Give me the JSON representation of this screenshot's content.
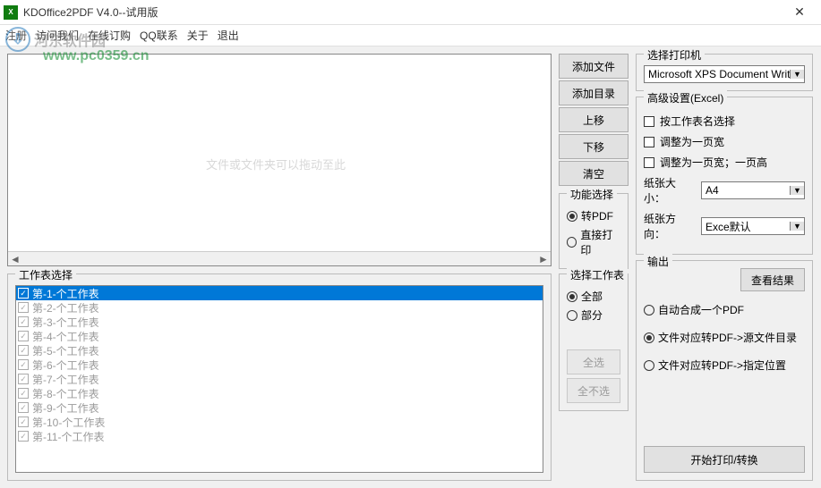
{
  "title": "KDOffice2PDF V4.0--试用版",
  "menu": {
    "register": "注册",
    "visit": "访问我们",
    "buy": "在线订购",
    "qq": "QQ联系",
    "about": "关于",
    "exit": "退出"
  },
  "watermark": {
    "site_cn": "河东软件园",
    "url": "www.pc0359.cn",
    "center_hint": "文件或文件夹可以拖动至此"
  },
  "file_actions": {
    "add_file": "添加文件",
    "add_dir": "添加目录",
    "move_up": "上移",
    "move_down": "下移",
    "clear": "清空"
  },
  "func": {
    "legend": "功能选择",
    "to_pdf": "转PDF",
    "print_direct": "直接打印"
  },
  "sheets": {
    "legend": "工作表选择",
    "items": [
      "第-1-个工作表",
      "第-2-个工作表",
      "第-3-个工作表",
      "第-4-个工作表",
      "第-5-个工作表",
      "第-6-个工作表",
      "第-7-个工作表",
      "第-8-个工作表",
      "第-9-个工作表",
      "第-10-个工作表",
      "第-11-个工作表"
    ]
  },
  "sheet_sel": {
    "legend": "选择工作表",
    "all": "全部",
    "part": "部分",
    "select_all": "全选",
    "select_none": "全不选"
  },
  "printer": {
    "legend": "选择打印机",
    "value": "Microsoft XPS Document Writer"
  },
  "advanced": {
    "legend": "高级设置(Excel)",
    "by_name": "按工作表名选择",
    "fit_width": "调整为一页宽",
    "fit_page": "调整为一页宽；一页高",
    "paper_size_label": "纸张大小：",
    "paper_size": "A4",
    "orient_label": "纸张方向：",
    "orient": "Exce默认"
  },
  "output": {
    "legend": "输出",
    "view_result": "查看结果",
    "merge_one": "自动合成一个PDF",
    "src_dir": "文件对应转PDF->源文件目录",
    "spec_dir": "文件对应转PDF->指定位置"
  },
  "start": "开始打印/转换"
}
